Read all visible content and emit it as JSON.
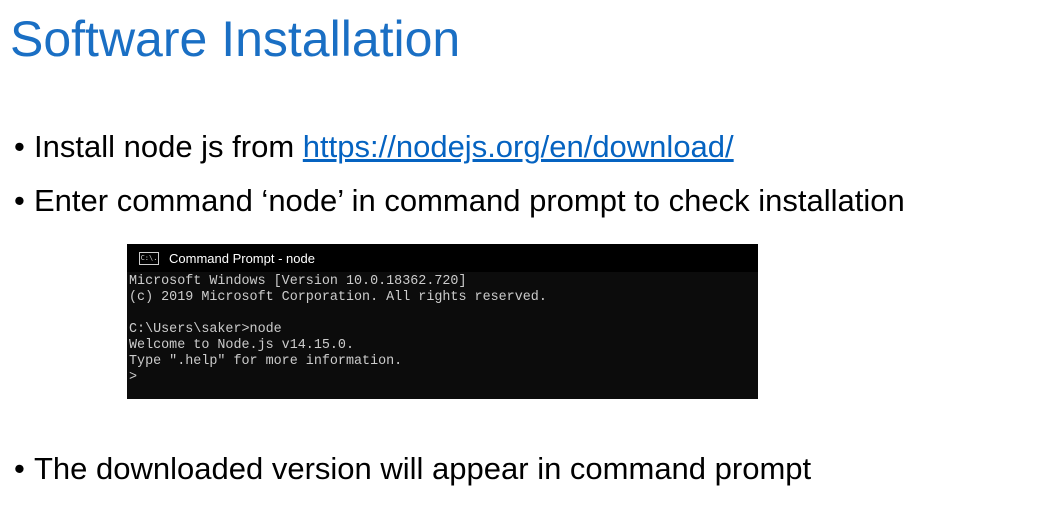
{
  "title": "Software Installation",
  "bullets": [
    {
      "text": "Install node js from ",
      "link": "https://nodejs.org/en/download/"
    },
    {
      "text": "Enter command ‘node’ in command prompt to check installation"
    },
    {
      "text": "The downloaded version will appear in command prompt"
    }
  ],
  "terminal": {
    "icon": "cmd-icon",
    "icon_text": "C:\\.",
    "window_title": "Command Prompt - node",
    "lines": [
      "Microsoft Windows [Version 10.0.18362.720]",
      "(c) 2019 Microsoft Corporation. All rights reserved.",
      "",
      "C:\\Users\\saker>node",
      "Welcome to Node.js v14.15.0.",
      "Type \".help\" for more information.",
      ">"
    ]
  },
  "colors": {
    "title": "#1a6fc4",
    "link": "#0563c1",
    "terminal_bg": "#0c0c0c"
  }
}
